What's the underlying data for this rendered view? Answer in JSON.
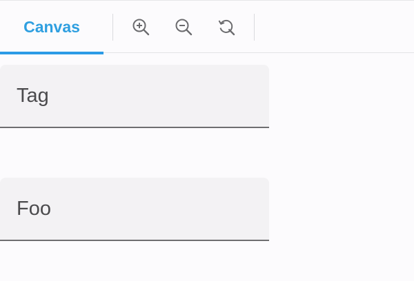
{
  "toolbar": {
    "tab_label": "Canvas",
    "icons": [
      "zoom-in-icon",
      "zoom-out-icon",
      "reset-zoom-icon"
    ]
  },
  "fields": [
    {
      "value": "Tag"
    },
    {
      "value": "Foo"
    }
  ],
  "colors": {
    "accent": "#2b9be6",
    "tab_text": "#2f9fe0",
    "field_bg": "#f3f2f4",
    "underline": "#6e6e70"
  }
}
